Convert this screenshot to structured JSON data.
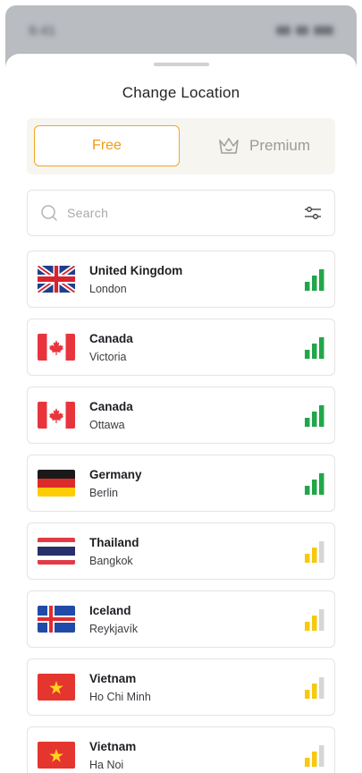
{
  "status_bar": {
    "time": "9:41"
  },
  "sheet": {
    "title": "Change Location"
  },
  "tabs": {
    "free_label": "Free",
    "premium_label": "Premium",
    "active": "free"
  },
  "search": {
    "placeholder": "Search",
    "value": ""
  },
  "colors": {
    "accent": "#f29a12",
    "signal_strong": "#22a64a",
    "signal_medium": "#f6c90e",
    "signal_empty": "#d6d6d6"
  },
  "locations": [
    {
      "country": "United Kingdom",
      "city": "London",
      "flag": "uk-flag",
      "signal_bars": 3,
      "signal_level": "strong"
    },
    {
      "country": "Canada",
      "city": "Victoria",
      "flag": "canada-flag",
      "signal_bars": 3,
      "signal_level": "strong"
    },
    {
      "country": "Canada",
      "city": "Ottawa",
      "flag": "canada-flag",
      "signal_bars": 3,
      "signal_level": "strong"
    },
    {
      "country": "Germany",
      "city": "Berlin",
      "flag": "germany-flag",
      "signal_bars": 3,
      "signal_level": "strong"
    },
    {
      "country": "Thailand",
      "city": "Bangkok",
      "flag": "thailand-flag",
      "signal_bars": 2,
      "signal_level": "medium"
    },
    {
      "country": "Iceland",
      "city": "Reykjavík",
      "flag": "iceland-flag",
      "signal_bars": 2,
      "signal_level": "medium"
    },
    {
      "country": "Vietnam",
      "city": "Ho Chi Minh",
      "flag": "vietnam-flag",
      "signal_bars": 2,
      "signal_level": "medium"
    },
    {
      "country": "Vietnam",
      "city": "Ha Noi",
      "flag": "vietnam-flag",
      "signal_bars": 2,
      "signal_level": "medium"
    }
  ]
}
